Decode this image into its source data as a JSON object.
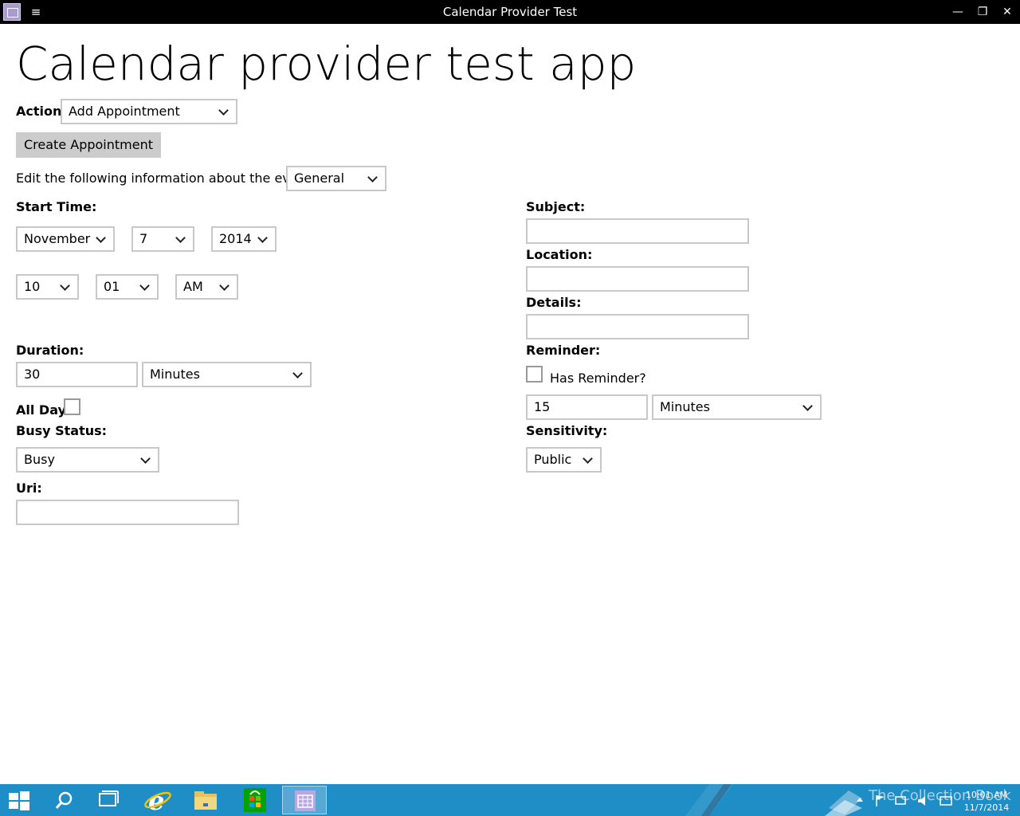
{
  "window": {
    "title": "Calendar Provider Test",
    "minimize_glyph": "—",
    "maximize_glyph": "❐",
    "close_glyph": "✕",
    "menu_glyph": "≡"
  },
  "main": {
    "heading": "Calendar provider test app",
    "action_label": "Action:",
    "action_value": "Add Appointment",
    "create_button": "Create Appointment",
    "edit_label": "Edit the following information about the event:",
    "edit_category": "General"
  },
  "start_time": {
    "label": "Start Time:",
    "month": "November",
    "day": "7",
    "year": "2014",
    "hour": "10",
    "minute": "01",
    "ampm": "AM"
  },
  "duration": {
    "label": "Duration:",
    "value": "30",
    "unit": "Minutes"
  },
  "all_day": {
    "label": "All Day:",
    "checked": false
  },
  "busy_status": {
    "label": "Busy Status:",
    "value": "Busy"
  },
  "uri": {
    "label": "Uri:",
    "value": ""
  },
  "subject": {
    "label": "Subject:",
    "value": ""
  },
  "location": {
    "label": "Location:",
    "value": ""
  },
  "details": {
    "label": "Details:",
    "value": ""
  },
  "reminder": {
    "label": "Reminder:",
    "checkbox_label": "Has Reminder?",
    "checked": false,
    "value": "15",
    "unit": "Minutes"
  },
  "sensitivity": {
    "label": "Sensitivity:",
    "value": "Public"
  },
  "taskbar": {
    "watermark": "The Collection Book",
    "time": "10:01 AM",
    "date": "11/7/2014",
    "colors": {
      "taskbar": "#1f8dc6",
      "store": "#00a300"
    },
    "icons": [
      "windows-start-icon",
      "search-icon",
      "task-view-icon",
      "internet-explorer-icon",
      "file-explorer-icon",
      "store-icon",
      "calendar-app-icon"
    ]
  }
}
